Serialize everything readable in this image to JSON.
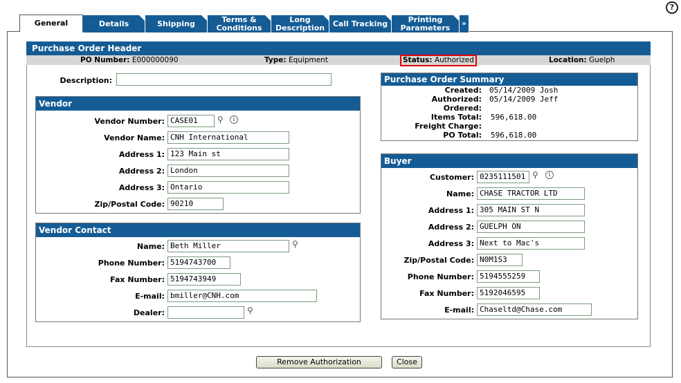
{
  "help_icon": "?",
  "tabs": [
    {
      "label": "General"
    },
    {
      "label": "Details"
    },
    {
      "label": "Shipping"
    },
    {
      "label": "Terms & Conditions"
    },
    {
      "label": "Long Description"
    },
    {
      "label": "Call Tracking"
    },
    {
      "label": "Printing Parameters"
    },
    {
      "label": "»"
    }
  ],
  "header": {
    "title": "Purchase Order Header",
    "po_number_label": "PO Number:",
    "po_number": "E000000090",
    "type_label": "Type:",
    "type": "Equipment",
    "status_label": "Status:",
    "status": "Authorized",
    "location_label": "Location:",
    "location": "Guelph"
  },
  "description": {
    "label": "Description:",
    "value": ""
  },
  "vendor": {
    "title": "Vendor",
    "fields": [
      {
        "label": "Vendor Number:",
        "value": "CASE01"
      },
      {
        "label": "Vendor Name:",
        "value": "CNH International"
      },
      {
        "label": "Address 1:",
        "value": "123 Main st"
      },
      {
        "label": "Address 2:",
        "value": "London"
      },
      {
        "label": "Address 3:",
        "value": "Ontario"
      },
      {
        "label": "Zip/Postal Code:",
        "value": "90210"
      }
    ]
  },
  "vendor_contact": {
    "title": "Vendor Contact",
    "fields": [
      {
        "label": "Name:",
        "value": "Beth Miller"
      },
      {
        "label": "Phone Number:",
        "value": "5194743700"
      },
      {
        "label": "Fax Number:",
        "value": "5194743949"
      },
      {
        "label": "E-mail:",
        "value": "bmiller@CNH.com"
      },
      {
        "label": "Dealer:",
        "value": ""
      }
    ]
  },
  "summary": {
    "title": "Purchase Order Summary",
    "rows": [
      {
        "label": "Created:",
        "value": "05/14/2009 Josh"
      },
      {
        "label": "Authorized:",
        "value": "05/14/2009 Jeff"
      },
      {
        "label": "Ordered:",
        "value": ""
      },
      {
        "label": "Items Total:",
        "value": "596,618.00"
      },
      {
        "label": "Freight Charge:",
        "value": ""
      },
      {
        "label": "PO Total:",
        "value": "596,618.00"
      }
    ]
  },
  "buyer": {
    "title": "Buyer",
    "fields": [
      {
        "label": "Customer:",
        "value": "0235111501"
      },
      {
        "label": "Name:",
        "value": "CHASE TRACTOR LTD"
      },
      {
        "label": "Address 1:",
        "value": "305 MAIN ST N"
      },
      {
        "label": "Address 2:",
        "value": "GUELPH ON"
      },
      {
        "label": "Address 3:",
        "value": "Next to Mac's"
      },
      {
        "label": "Zip/Postal Code:",
        "value": "N0M1S3"
      },
      {
        "label": "Phone Number:",
        "value": "5194555259"
      },
      {
        "label": "Fax Number:",
        "value": "5192046595"
      },
      {
        "label": "E-mail:",
        "value": "Chaseltd@Chase.com"
      }
    ]
  },
  "buttons": {
    "remove_authorization": "Remove Authorization",
    "close": "Close"
  },
  "icons": {
    "lookup": "magnifier-icon",
    "info": "info-icon",
    "info_glyph": "i"
  },
  "colors": {
    "accent": "#155c95",
    "status_highlight": "#e00000",
    "info_bar": "#d6d6d6"
  }
}
